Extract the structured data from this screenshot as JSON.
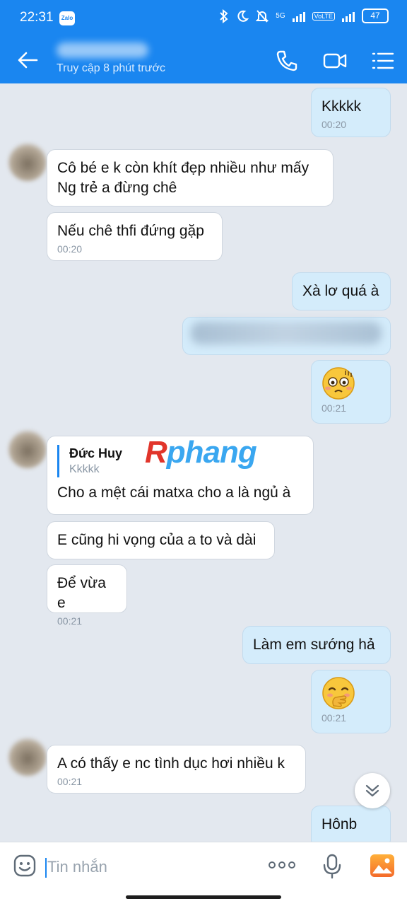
{
  "status": {
    "time": "22:31",
    "app_badge": "Zalo",
    "network": "5G",
    "volte": "VoLTE",
    "battery": "47"
  },
  "header": {
    "subtitle": "Truy cập 8 phút trước"
  },
  "messages": [
    {
      "text": "Kkkkk",
      "time": "00:20"
    },
    {
      "text": "Cô bé e k còn khít đẹp nhiều như mấy Ng trẻ a đừng chê"
    },
    {
      "text": "Nếu chê thfi đứng gặp",
      "time": "00:20"
    },
    {
      "text": "Xà lơ quá à"
    },
    {
      "time": "00:21",
      "emoji": "flushed-face-emoji"
    },
    {
      "quote_name": "Đức Huy",
      "quote_text": "Kkkkk",
      "text": "Cho a mệt cái matxa cho a là ngủ à"
    },
    {
      "text": "E cũng hi vọng của a to và dài"
    },
    {
      "text": "Để vừa e",
      "time": "00:21"
    },
    {
      "text": "Làm em sướng hả"
    },
    {
      "time": "00:21",
      "emoji": "hand-over-mouth-emoji"
    },
    {
      "text": "A có thấy e nc tình dục hơi nhiều k",
      "time": "00:21"
    },
    {
      "text": "Hônb"
    }
  ],
  "watermark": {
    "first": "R",
    "rest": "phang"
  },
  "input": {
    "placeholder": "Tin nhắn"
  },
  "colors": {
    "header": "#1a86f0",
    "outgoing_bubble": "#d4ecfb",
    "incoming_bubble": "#ffffff",
    "background": "#e3e8ef"
  }
}
